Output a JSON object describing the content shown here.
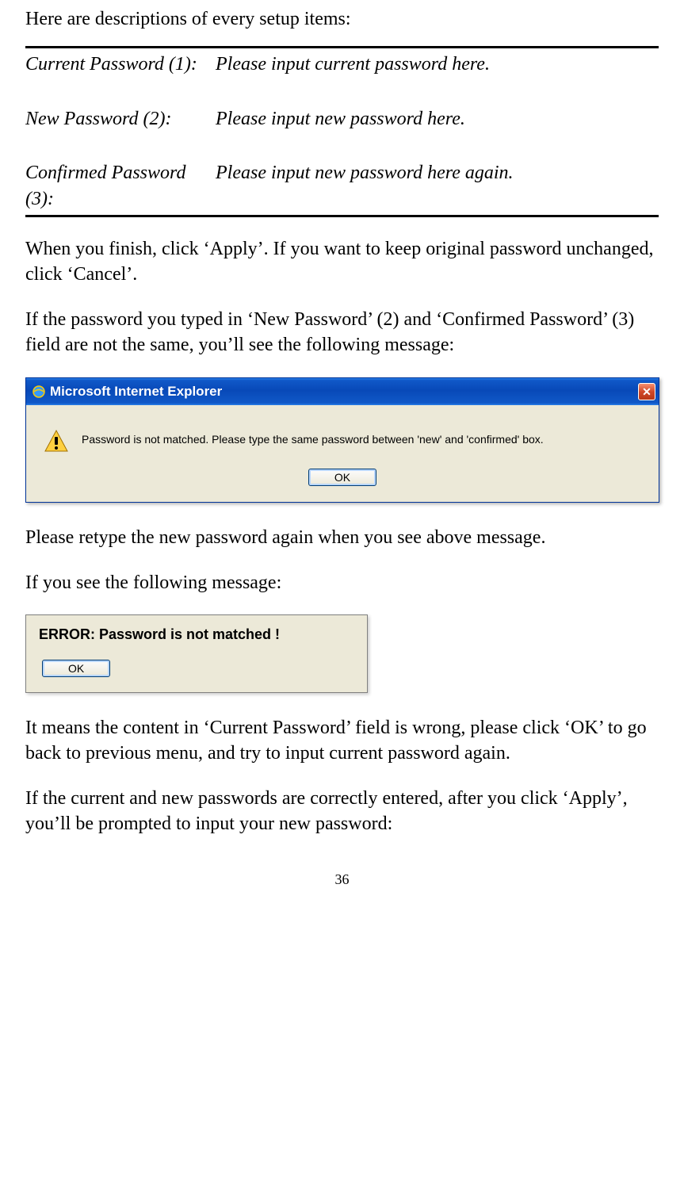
{
  "intro": "Here are descriptions of every setup items:",
  "table": {
    "rows": [
      {
        "label": "Current Password (1):",
        "desc": "Please input current password here."
      },
      {
        "label": "New Password (2):",
        "desc": "Please input new password here."
      },
      {
        "label": "Confirmed Password (3):",
        "desc": "Please input new password here again."
      }
    ]
  },
  "para1": "When you finish, click ‘Apply’. If you want to keep original password unchanged, click ‘Cancel’.",
  "para2": "If the password you typed in ‘New Password’ (2) and ‘Confirmed Password’ (3) field are not the same, you’ll see the following message:",
  "dialog1": {
    "title": "Microsoft Internet Explorer",
    "message": "Password is not matched. Please type the same password between 'new' and 'confirmed' box.",
    "ok": "OK"
  },
  "para3": "Please retype the new password again when you see above message.",
  "para4": "If you see the following message:",
  "dialog2": {
    "error": "ERROR: Password is not matched !",
    "ok": "OK"
  },
  "para5": "It means the content in ‘Current Password’ field is wrong, please click ‘OK’ to go back to previous menu, and try to input current password again.",
  "para6": "If the current and new passwords are correctly entered, after you click ‘Apply’, you’ll be prompted to input your new password:",
  "pageNumber": "36"
}
